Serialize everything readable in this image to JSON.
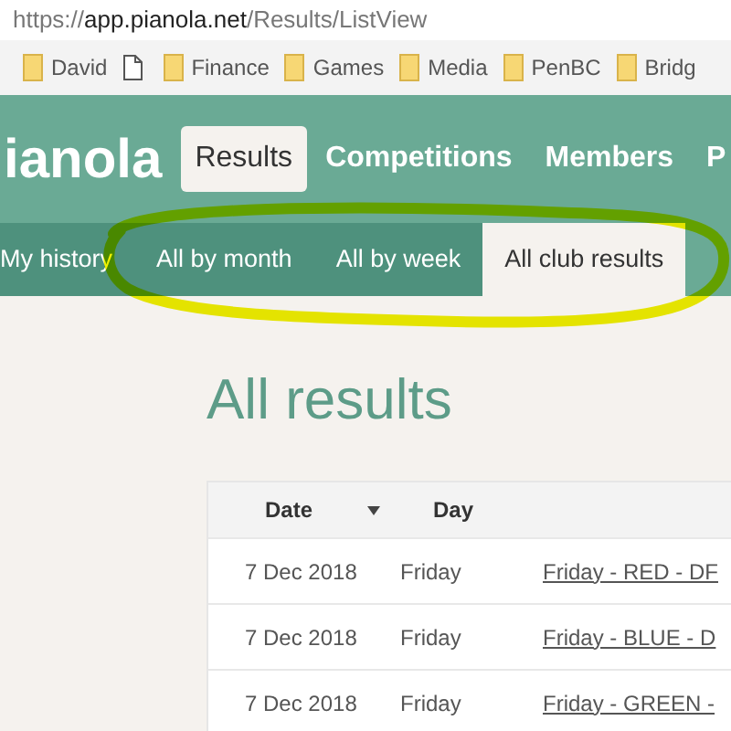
{
  "address_bar": {
    "scheme": "https://",
    "host": "app.pianola.net",
    "path": "/Results/ListView"
  },
  "bookmarks": [
    {
      "kind": "folder",
      "label": "David"
    },
    {
      "kind": "page"
    },
    {
      "kind": "folder",
      "label": "Finance"
    },
    {
      "kind": "folder",
      "label": "Games"
    },
    {
      "kind": "folder",
      "label": "Media"
    },
    {
      "kind": "folder",
      "label": "PenBC"
    },
    {
      "kind": "folder",
      "label": "Bridg"
    }
  ],
  "header": {
    "logo": "ianola",
    "nav": [
      {
        "label": "Results",
        "selected": true
      },
      {
        "label": "Competitions",
        "selected": false
      },
      {
        "label": "Members",
        "selected": false
      },
      {
        "label": "P",
        "selected": false
      }
    ]
  },
  "subnav": [
    {
      "label": "My history",
      "selected": false
    },
    {
      "label": "All by month",
      "selected": false
    },
    {
      "label": "All by week",
      "selected": false
    },
    {
      "label": "All club results",
      "selected": true
    }
  ],
  "heading": "All results",
  "table": {
    "columns": [
      {
        "label": "Date",
        "sorted": true
      },
      {
        "label": "Day",
        "sorted": false
      }
    ],
    "rows": [
      {
        "date": "7 Dec 2018",
        "day": "Friday",
        "event": "Friday - RED - DF"
      },
      {
        "date": "7 Dec 2018",
        "day": "Friday",
        "event": "Friday - BLUE - D"
      },
      {
        "date": "7 Dec 2018",
        "day": "Friday",
        "event": "Friday - GREEN -"
      }
    ]
  }
}
